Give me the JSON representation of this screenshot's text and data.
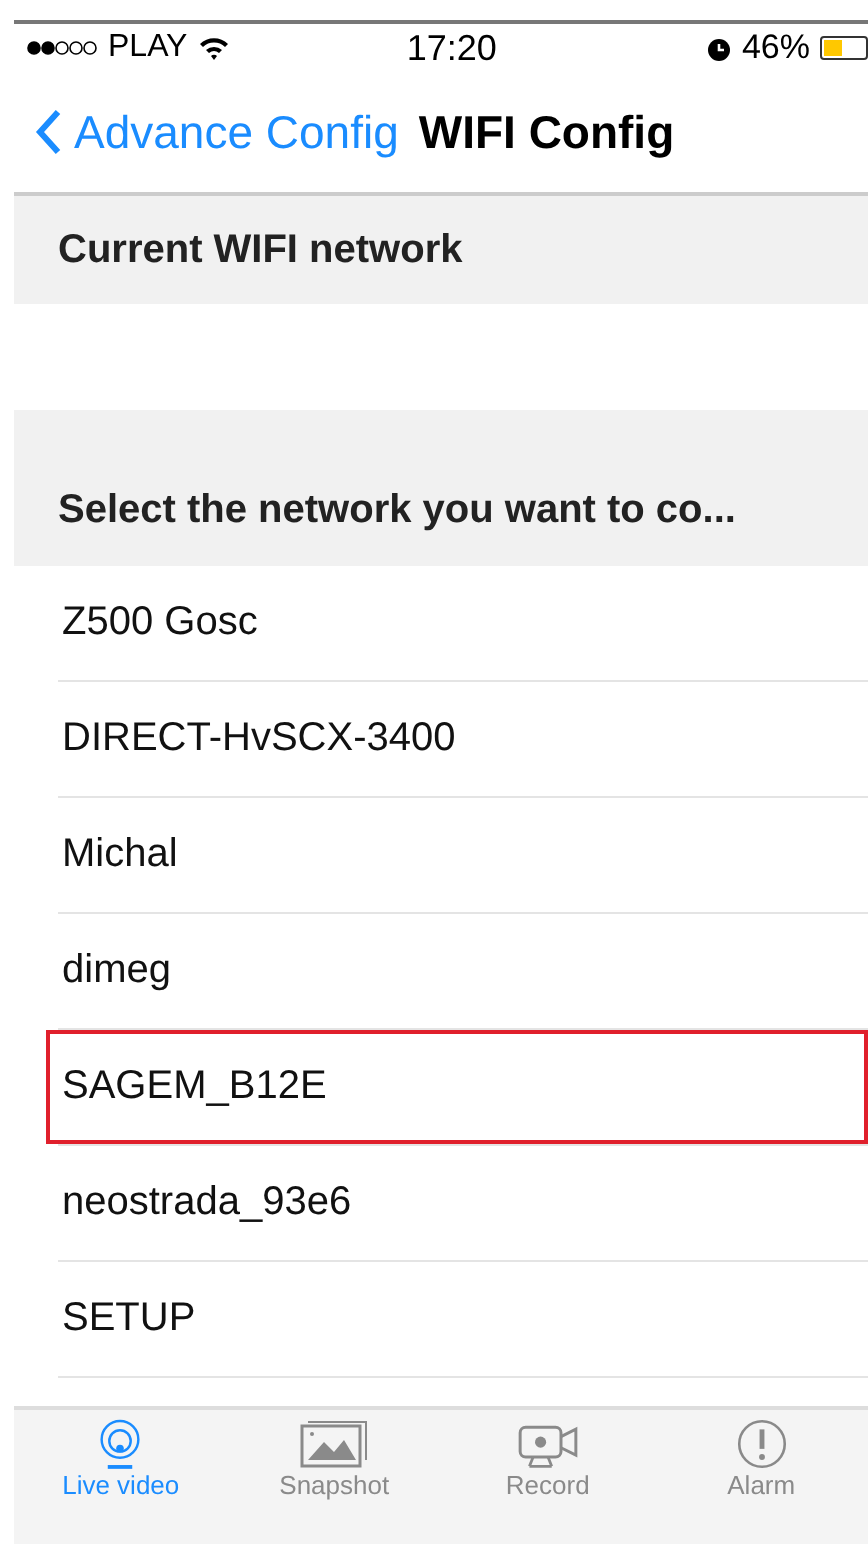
{
  "status_bar": {
    "carrier": "PLAY",
    "time": "17:20",
    "battery_text": "46%",
    "battery": {
      "level": 0.46
    }
  },
  "nav": {
    "back_label": "Advance Config",
    "title": "WIFI Config"
  },
  "current_section": {
    "header": "Current WIFI network"
  },
  "select_section": {
    "header": "Select the network you want to co..."
  },
  "networks": [
    {
      "name": "Z500 Gosc",
      "highlighted": false
    },
    {
      "name": "DIRECT-HvSCX-3400",
      "highlighted": false
    },
    {
      "name": "Michal",
      "highlighted": false
    },
    {
      "name": "dimeg",
      "highlighted": false
    },
    {
      "name": "SAGEM_B12E",
      "highlighted": true
    },
    {
      "name": "neostrada_93e6",
      "highlighted": false
    },
    {
      "name": "SETUP",
      "highlighted": false
    }
  ],
  "tabs": [
    {
      "kind": "live",
      "label": "Live video",
      "selected": true
    },
    {
      "kind": "snapshot",
      "label": "Snapshot",
      "selected": false
    },
    {
      "kind": "record",
      "label": "Record",
      "selected": false
    },
    {
      "kind": "alarm",
      "label": "Alarm",
      "selected": false
    }
  ]
}
